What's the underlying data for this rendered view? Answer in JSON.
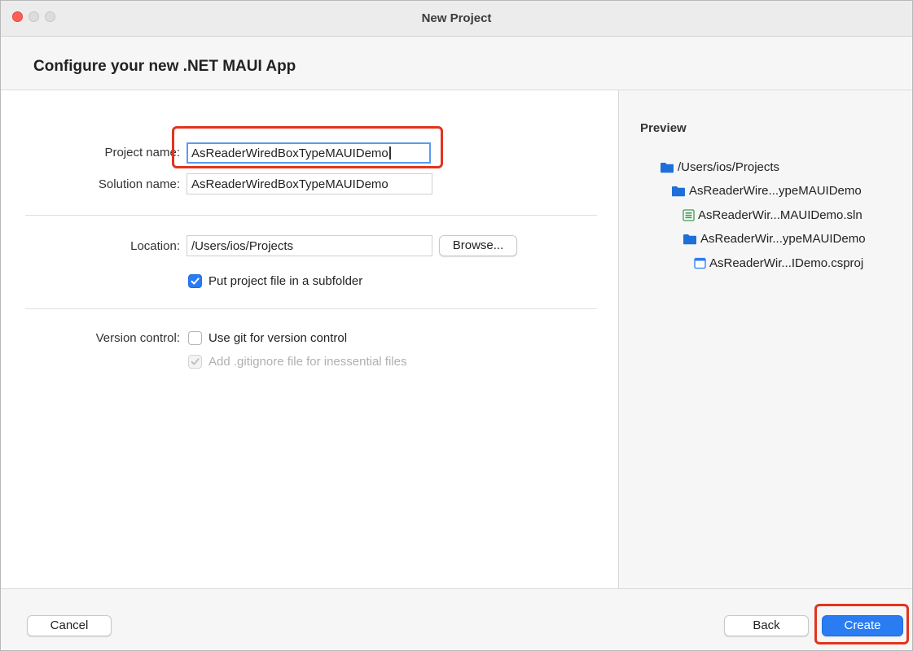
{
  "window": {
    "title": "New Project"
  },
  "header": {
    "title": "Configure your new .NET MAUI App"
  },
  "form": {
    "project_name_label": "Project name:",
    "project_name_value": "AsReaderWiredBoxTypeMAUIDemo",
    "solution_name_label": "Solution name:",
    "solution_name_value": "AsReaderWiredBoxTypeMAUIDemo",
    "location_label": "Location:",
    "location_value": "/Users/ios/Projects",
    "browse_label": "Browse...",
    "subfolder_label": "Put project file in a subfolder",
    "subfolder_checked": true,
    "version_control_label": "Version control:",
    "use_git_label": "Use git for version control",
    "use_git_checked": false,
    "gitignore_label": "Add .gitignore file for inessential files",
    "gitignore_checked": true,
    "gitignore_enabled": false
  },
  "preview": {
    "title": "Preview",
    "tree": [
      {
        "label": "/Users/ios/Projects",
        "icon": "folder-icon"
      },
      {
        "label": "AsReaderWire...ypeMAUIDemo",
        "icon": "folder-icon"
      },
      {
        "label": "AsReaderWir...MAUIDemo.sln",
        "icon": "solution-file-icon"
      },
      {
        "label": "AsReaderWir...ypeMAUIDemo",
        "icon": "folder-icon"
      },
      {
        "label": "AsReaderWir...IDemo.csproj",
        "icon": "project-file-icon"
      }
    ]
  },
  "footer": {
    "cancel_label": "Cancel",
    "back_label": "Back",
    "create_label": "Create"
  },
  "colors": {
    "accent": "#2a7cf3",
    "highlight_annotation": "#e2341d",
    "folder": "#1f6fd8",
    "solution_file": "#3b9a4a"
  }
}
